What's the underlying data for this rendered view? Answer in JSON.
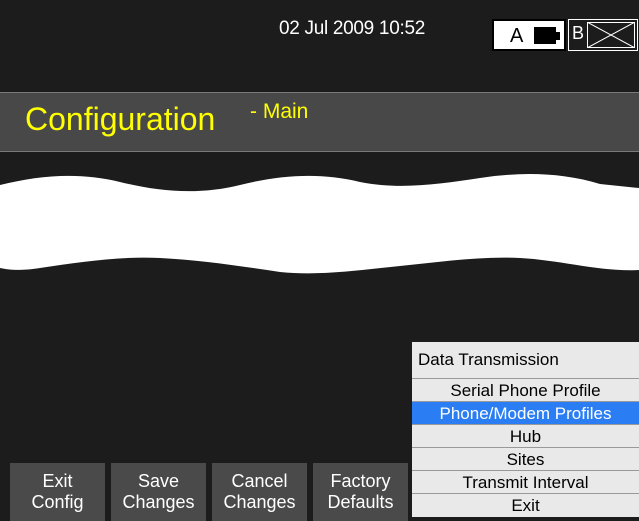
{
  "status_bar": {
    "datetime": "02 Jul 2009 10:52",
    "battery_a_label": "A",
    "battery_b_label": "B"
  },
  "header": {
    "title": "Configuration",
    "subtitle": "- Main"
  },
  "softkeys": [
    {
      "line1": "Exit",
      "line2": "Config"
    },
    {
      "line1": "Save",
      "line2": "Changes"
    },
    {
      "line1": "Cancel",
      "line2": "Changes"
    },
    {
      "line1": "Factory",
      "line2": "Defaults"
    }
  ],
  "menu": {
    "header": "Data Transmission",
    "items": [
      {
        "label": "Serial Phone Profile"
      },
      {
        "label": "Phone/Modem Profiles"
      },
      {
        "label": "Hub"
      },
      {
        "label": "Sites"
      },
      {
        "label": "Transmit Interval"
      },
      {
        "label": "Exit"
      }
    ],
    "selected_index": 1
  },
  "colors": {
    "title": "#ffff00",
    "selected": "#2a7df2",
    "background": "#1c1c1c"
  }
}
